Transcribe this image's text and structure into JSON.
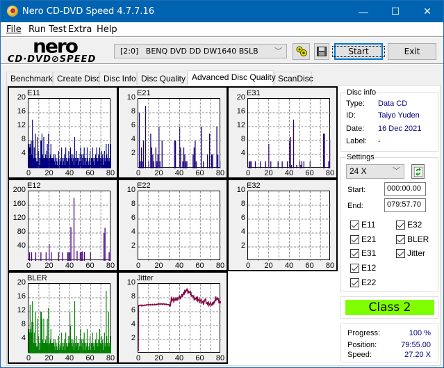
{
  "window": {
    "title": "Nero CD-DVD Speed 4.7.7.16",
    "controls": {
      "minimize": "—",
      "maximize": "☐",
      "close": "✕"
    }
  },
  "menu": [
    {
      "label": "File",
      "accel": "F"
    },
    {
      "label": "Run Test",
      "accel": "R"
    },
    {
      "label": "Extra",
      "accel": "E"
    },
    {
      "label": "Help",
      "accel": "H"
    }
  ],
  "logo": {
    "top": "nero",
    "bottom": "CD·DVD⊘SPEED"
  },
  "toolbar": {
    "drive": "[2:0]   BENQ DVD DD DW1640 BSLB",
    "start_label": "Start",
    "exit_label": "Exit",
    "icons": [
      "drive-info-icon",
      "save-icon"
    ]
  },
  "tabs": [
    {
      "label": "Benchmark",
      "active": false
    },
    {
      "label": "Create Disc",
      "active": false
    },
    {
      "label": "Disc Info",
      "active": false
    },
    {
      "label": "Disc Quality",
      "active": false
    },
    {
      "label": "Advanced Disc Quality",
      "active": true
    },
    {
      "label": "ScanDisc",
      "active": false
    }
  ],
  "disc_info": {
    "group_label": "Disc info",
    "type_label": "Type:",
    "type": "Data CD",
    "id_label": "ID:",
    "id": "Taiyo Yuden",
    "date_label": "Date:",
    "date": "16 Dec 2021",
    "label_label": "Label:",
    "label": "-"
  },
  "settings": {
    "group_label": "Settings",
    "speed": "24 X",
    "start_label": "Start:",
    "start": "000:00.00",
    "end_label": "End:",
    "end": "079:57.70",
    "checkboxes": [
      {
        "label": "E11",
        "checked": true
      },
      {
        "label": "E21",
        "checked": true
      },
      {
        "label": "E31",
        "checked": true
      },
      {
        "label": "E12",
        "checked": true
      },
      {
        "label": "E22",
        "checked": true
      },
      {
        "label": "E32",
        "checked": true
      },
      {
        "label": "BLER",
        "checked": true
      },
      {
        "label": "Jitter",
        "checked": true
      }
    ]
  },
  "result": {
    "class": "Class 2",
    "color": "#80ff00"
  },
  "status": {
    "progress_label": "Progress:",
    "progress": "100 %",
    "position_label": "Position:",
    "position": "79:55.00",
    "speed_label": "Speed:",
    "speed": "27.20 X"
  },
  "chart_data": [
    {
      "name": "E11",
      "type": "bar",
      "color": "#000080",
      "xlim": [
        0,
        80
      ],
      "ylim": [
        0,
        20
      ],
      "xticks": [
        "0",
        "20",
        "40",
        "60",
        "80"
      ],
      "yticks": [
        "20",
        "16",
        "12",
        "8",
        "4"
      ],
      "grid": true,
      "values": [
        7,
        6,
        7,
        6,
        8,
        4,
        14,
        8,
        3,
        6,
        3,
        10,
        3,
        2,
        2,
        9,
        5,
        3,
        1,
        3,
        8,
        8,
        10,
        4,
        3,
        9,
        3,
        3,
        4,
        3,
        5,
        7,
        3,
        10,
        2,
        3,
        4,
        7,
        3,
        3,
        3,
        4,
        3,
        2,
        4,
        1,
        3,
        2,
        1,
        3,
        5,
        1,
        2,
        3,
        2,
        6,
        1,
        3,
        2,
        3,
        4,
        1,
        6,
        3,
        2,
        2,
        3,
        5,
        3,
        1,
        6,
        4,
        3,
        2,
        4,
        3,
        1,
        9,
        3,
        2,
        5,
        3,
        3,
        1,
        3,
        2,
        4,
        6,
        2,
        4,
        3,
        1,
        4,
        6,
        3,
        1,
        3,
        2,
        6,
        3,
        1,
        2,
        3,
        5,
        1,
        3,
        3,
        6,
        3,
        2,
        3,
        1,
        4,
        3,
        6,
        3,
        2,
        4,
        3,
        6,
        3,
        2,
        5,
        3,
        4,
        1,
        3,
        5,
        2,
        3,
        7,
        4,
        3,
        2,
        7,
        3,
        2,
        3,
        7
      ]
    },
    {
      "name": "E21",
      "type": "bar",
      "color": "#1a0080",
      "xlim": [
        0,
        80
      ],
      "ylim": [
        0,
        10
      ],
      "xticks": [
        "0",
        "20",
        "40",
        "60",
        "80"
      ],
      "yticks": [
        "10",
        "8",
        "6",
        "4",
        "2"
      ],
      "grid": true,
      "spikes": [
        [
          1,
          8
        ],
        [
          2,
          1
        ],
        [
          3,
          3
        ],
        [
          4,
          1
        ],
        [
          5,
          4
        ],
        [
          7,
          9
        ],
        [
          10,
          1
        ],
        [
          12,
          5
        ],
        [
          13,
          3
        ],
        [
          14,
          2
        ],
        [
          15,
          1
        ],
        [
          17,
          3
        ],
        [
          18,
          1
        ],
        [
          19,
          2
        ],
        [
          20,
          6
        ],
        [
          21,
          1
        ],
        [
          23,
          4
        ],
        [
          35,
          4
        ],
        [
          36,
          4
        ],
        [
          40,
          6
        ],
        [
          41,
          3
        ],
        [
          43,
          1
        ],
        [
          44,
          3
        ],
        [
          45,
          2
        ],
        [
          46,
          1
        ],
        [
          47,
          1
        ],
        [
          53,
          2
        ],
        [
          54,
          3
        ],
        [
          55,
          4
        ],
        [
          56,
          1
        ],
        [
          61,
          6
        ],
        [
          63,
          1
        ],
        [
          67,
          2
        ],
        [
          69,
          5
        ],
        [
          71,
          2
        ],
        [
          72,
          2
        ],
        [
          76,
          6
        ],
        [
          77,
          2
        ],
        [
          79,
          1
        ]
      ]
    },
    {
      "name": "E31",
      "type": "bar",
      "color": "#2a0070",
      "xlim": [
        0,
        80
      ],
      "ylim": [
        0,
        20
      ],
      "xticks": [
        "0",
        "20",
        "40",
        "60",
        "80"
      ],
      "yticks": [
        "20",
        "16",
        "12",
        "8",
        "4"
      ],
      "grid": true,
      "spikes": [
        [
          1,
          2
        ],
        [
          2,
          2
        ],
        [
          3,
          2
        ],
        [
          7,
          2
        ],
        [
          12,
          2
        ],
        [
          17,
          2
        ],
        [
          20,
          7
        ],
        [
          22,
          2
        ],
        [
          29,
          2
        ],
        [
          33,
          2
        ],
        [
          38,
          2
        ],
        [
          40,
          8
        ],
        [
          41,
          9
        ],
        [
          42,
          1
        ],
        [
          44,
          14
        ],
        [
          47,
          1
        ],
        [
          50,
          2
        ],
        [
          51,
          1
        ],
        [
          52,
          2
        ],
        [
          54,
          2
        ],
        [
          60,
          2
        ],
        [
          73,
          10
        ],
        [
          74,
          10
        ],
        [
          78,
          2
        ],
        [
          79,
          8
        ]
      ]
    },
    {
      "name": "E12",
      "type": "bar",
      "color": "#4b0082",
      "xlim": [
        0,
        80
      ],
      "ylim": [
        0,
        200
      ],
      "xticks": [
        "0",
        "20",
        "40",
        "60",
        "80"
      ],
      "yticks": [
        "200",
        "160",
        "120",
        "80",
        "40"
      ],
      "grid": true,
      "spikes": [
        [
          1,
          25
        ],
        [
          3,
          25
        ],
        [
          7,
          25
        ],
        [
          12,
          25
        ],
        [
          17,
          25
        ],
        [
          20,
          48
        ],
        [
          22,
          25
        ],
        [
          29,
          25
        ],
        [
          33,
          25
        ],
        [
          38,
          25
        ],
        [
          39,
          25
        ],
        [
          40,
          25
        ],
        [
          41,
          97
        ],
        [
          44,
          181
        ],
        [
          47,
          28
        ],
        [
          50,
          24
        ],
        [
          51,
          26
        ],
        [
          52,
          27
        ],
        [
          54,
          26
        ],
        [
          60,
          26
        ],
        [
          73,
          80
        ],
        [
          74,
          95
        ],
        [
          78,
          25
        ],
        [
          79,
          33
        ]
      ]
    },
    {
      "name": "E22",
      "type": "bar",
      "color": "#000080",
      "xlim": [
        0,
        80
      ],
      "ylim": [
        0,
        10
      ],
      "xticks": [
        "0",
        "20",
        "40",
        "60",
        "80"
      ],
      "yticks": [
        "10",
        "8",
        "6",
        "4",
        "2"
      ],
      "grid": true,
      "values": []
    },
    {
      "name": "E32",
      "type": "bar",
      "color": "#000080",
      "xlim": [
        0,
        80
      ],
      "ylim": [
        0,
        10
      ],
      "xticks": [
        "0",
        "20",
        "40",
        "60",
        "80"
      ],
      "yticks": [
        "10",
        "8",
        "6",
        "4",
        "2"
      ],
      "grid": true,
      "values": []
    },
    {
      "name": "BLER",
      "type": "bar",
      "color": "#008000",
      "xlim": [
        0,
        80
      ],
      "ylim": [
        0,
        20
      ],
      "xticks": [
        "0",
        "20",
        "40",
        "60",
        "80"
      ],
      "yticks": [
        "20",
        "16",
        "12",
        "8",
        "4"
      ],
      "grid": true,
      "values": [
        7,
        6,
        14,
        7,
        6,
        9,
        15,
        9,
        3,
        6,
        3,
        12,
        3,
        2,
        2,
        10,
        5,
        3,
        1,
        3,
        12,
        12,
        10,
        4,
        3,
        10,
        3,
        3,
        4,
        3,
        5,
        10,
        3,
        13,
        2,
        3,
        4,
        7,
        3,
        3,
        3,
        4,
        3,
        2,
        4,
        1,
        3,
        2,
        1,
        3,
        5,
        1,
        2,
        3,
        2,
        6,
        1,
        3,
        2,
        3,
        4,
        1,
        6,
        3,
        2,
        2,
        3,
        5,
        3,
        12,
        8,
        4,
        3,
        2,
        4,
        3,
        1,
        15,
        3,
        2,
        5,
        3,
        3,
        1,
        3,
        2,
        4,
        7,
        2,
        4,
        3,
        1,
        4,
        6,
        3,
        1,
        3,
        2,
        7,
        3,
        1,
        2,
        3,
        5,
        1,
        3,
        3,
        6,
        3,
        2,
        3,
        1,
        4,
        3,
        6,
        3,
        2,
        4,
        3,
        7,
        3,
        2,
        5,
        3,
        4,
        1,
        3,
        6,
        2,
        3,
        18,
        5,
        3,
        2,
        12,
        3,
        2,
        3,
        5
      ]
    },
    {
      "name": "Jitter",
      "type": "line",
      "color": "#800040",
      "xlim": [
        0,
        80
      ],
      "ylim": [
        0,
        10
      ],
      "xticks": [
        "0",
        "20",
        "40",
        "60",
        "80"
      ],
      "yticks": [
        "10",
        "8",
        "6",
        "4",
        "2"
      ],
      "grid": true,
      "points": [
        [
          0,
          0.3
        ],
        [
          0.3,
          6.9
        ],
        [
          5,
          6.9
        ],
        [
          10,
          7.0
        ],
        [
          15,
          7.0
        ],
        [
          20,
          7.1
        ],
        [
          25,
          7.1
        ],
        [
          29,
          7.0
        ],
        [
          31,
          7.0
        ],
        [
          32,
          7.8
        ],
        [
          35,
          7.7
        ],
        [
          38,
          7.9
        ],
        [
          40,
          8.0
        ],
        [
          43,
          8.4
        ],
        [
          45,
          8.9
        ],
        [
          47,
          9.0
        ],
        [
          49,
          8.9
        ],
        [
          51,
          8.6
        ],
        [
          53,
          8.1
        ],
        [
          55,
          8.0
        ],
        [
          57,
          7.8
        ],
        [
          60,
          7.6
        ],
        [
          63,
          7.3
        ],
        [
          65,
          7.6
        ],
        [
          67,
          7.2
        ],
        [
          70,
          7.1
        ],
        [
          72,
          7.0
        ],
        [
          74,
          7.6
        ],
        [
          75,
          8.0
        ],
        [
          77,
          7.8
        ],
        [
          79,
          7.4
        ],
        [
          80,
          7.5
        ]
      ]
    }
  ]
}
